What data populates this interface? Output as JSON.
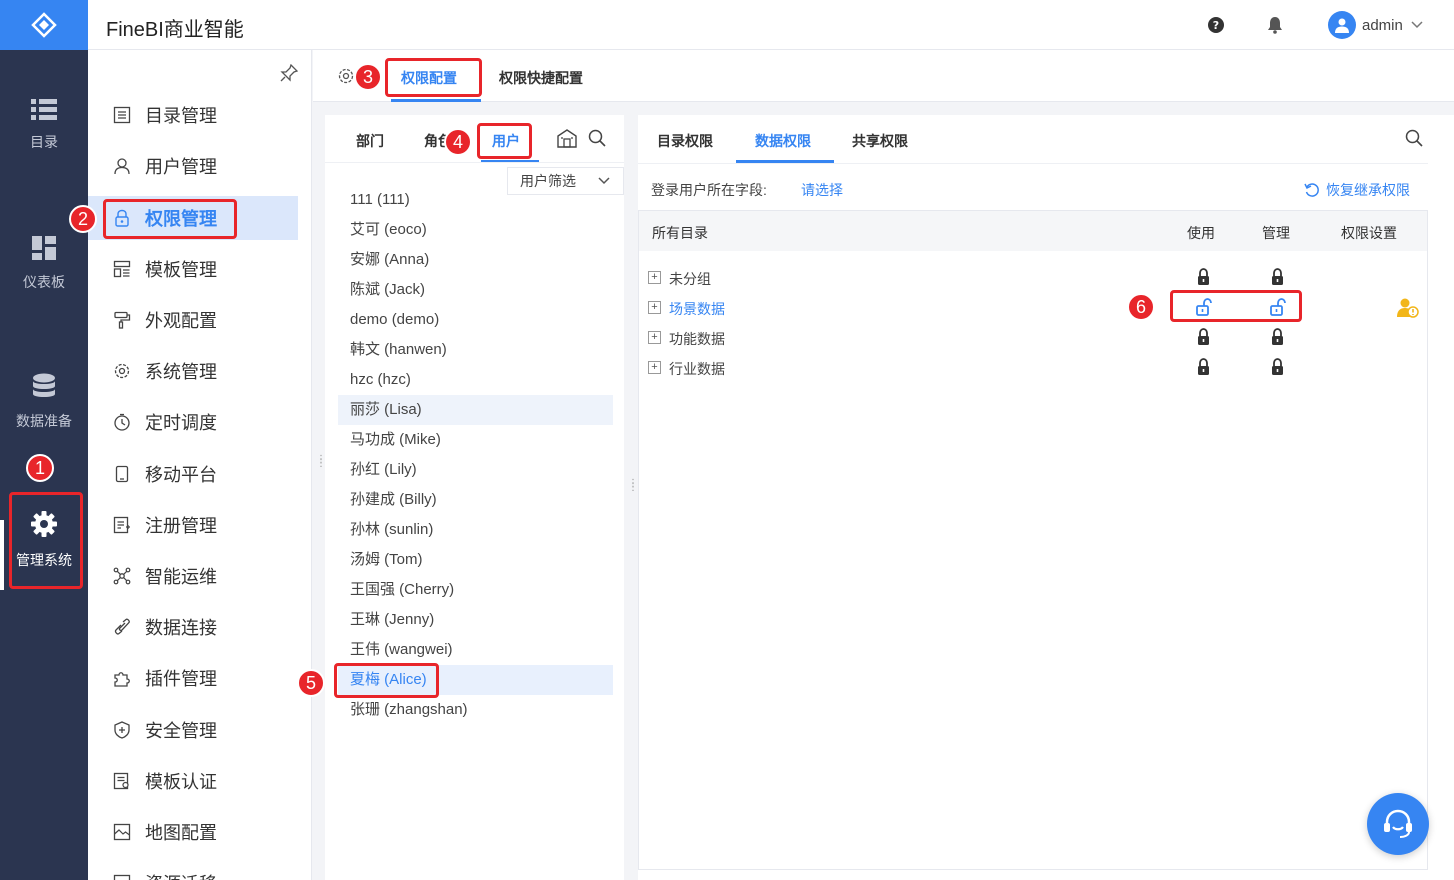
{
  "app": {
    "title": "FineBI商业智能"
  },
  "header": {
    "user_name": "admin"
  },
  "leftnav": {
    "items": [
      {
        "label": "目录",
        "icon": "list-icon"
      },
      {
        "label": "仪表板",
        "icon": "dashboard-icon"
      },
      {
        "label": "数据准备",
        "icon": "database-icon"
      },
      {
        "label": "管理系统",
        "icon": "gear-icon"
      }
    ]
  },
  "submenu": {
    "items": [
      {
        "label": "目录管理"
      },
      {
        "label": "用户管理"
      },
      {
        "label": "权限管理"
      },
      {
        "label": "模板管理"
      },
      {
        "label": "外观配置"
      },
      {
        "label": "系统管理"
      },
      {
        "label": "定时调度"
      },
      {
        "label": "移动平台"
      },
      {
        "label": "注册管理"
      },
      {
        "label": "智能运维"
      },
      {
        "label": "数据连接"
      },
      {
        "label": "插件管理"
      },
      {
        "label": "安全管理"
      },
      {
        "label": "模板认证"
      },
      {
        "label": "地图配置"
      },
      {
        "label": "资源迁移"
      }
    ]
  },
  "main_tabs": [
    {
      "label": "权限配置"
    },
    {
      "label": "权限快捷配置"
    }
  ],
  "user_panel": {
    "tabs": [
      {
        "label": "部门"
      },
      {
        "label": "角色"
      },
      {
        "label": "用户"
      }
    ],
    "filter_label": "用户筛选",
    "users": [
      "111 (111)",
      "艾可 (eoco)",
      "安娜 (Anna)",
      "陈斌 (Jack)",
      "demo (demo)",
      "韩文 (hanwen)",
      "hzc (hzc)",
      "丽莎 (Lisa)",
      "马功成 (Mike)",
      "孙红 (Lily)",
      "孙建成 (Billy)",
      "孙林 (sunlin)",
      "汤姆 (Tom)",
      "王国强 (Cherry)",
      "王琳 (Jenny)",
      "王伟 (wangwei)",
      "夏梅 (Alice)",
      "张珊 (zhangshan)"
    ]
  },
  "perm_panel": {
    "tabs": [
      {
        "label": "目录权限"
      },
      {
        "label": "数据权限"
      },
      {
        "label": "共享权限"
      }
    ],
    "field_label": "登录用户所在字段:",
    "field_select": "请选择",
    "restore_label": "恢复继承权限",
    "columns": {
      "all": "所有目录",
      "use": "使用",
      "manage": "管理",
      "settings": "权限设置"
    },
    "rows": [
      {
        "label": "未分组",
        "use": "locked",
        "manage": "locked"
      },
      {
        "label": "场景数据",
        "use": "unlocked",
        "manage": "unlocked"
      },
      {
        "label": "功能数据",
        "use": "locked",
        "manage": "locked"
      },
      {
        "label": "行业数据",
        "use": "locked",
        "manage": "locked"
      }
    ]
  },
  "annotations": {
    "b1": "1",
    "b2": "2",
    "b3": "3",
    "b4": "4",
    "b5": "5",
    "b6": "6"
  },
  "colors": {
    "accent": "#3685f2",
    "nav_bg": "#2b3550",
    "highlight": "#e8252a"
  }
}
